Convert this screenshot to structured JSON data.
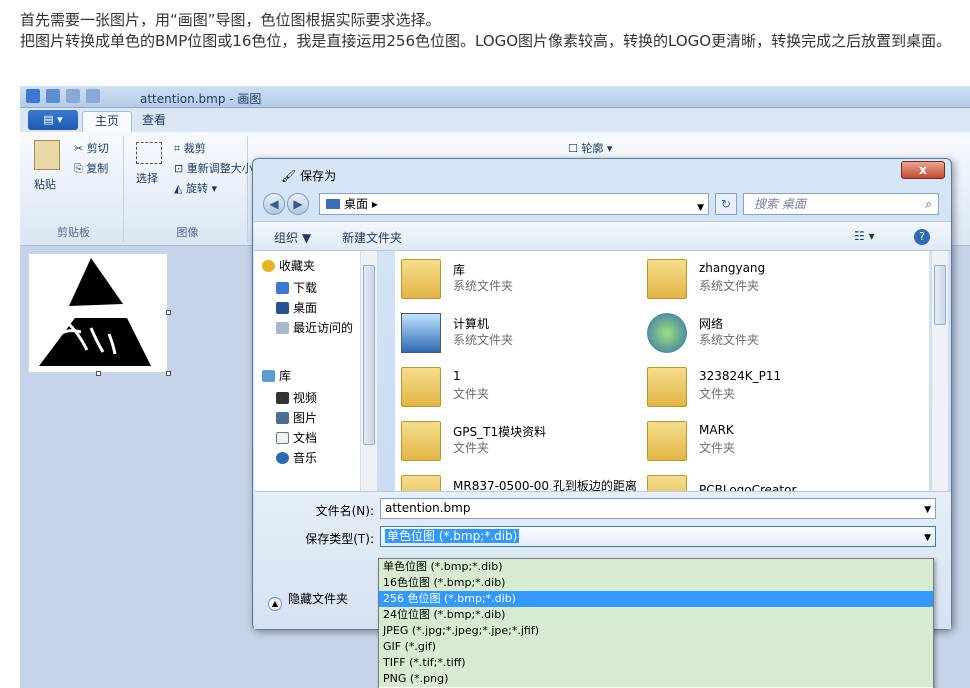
{
  "intro": {
    "line1": "首先需要一张图片，用“画图”导图，色位图根据实际要求选择。",
    "line2": "把图片转换成单色的BMP位图或16色位，我是直接运用256色位图。LOGO图片像素较高，转换的LOGO更清晰，转换完成之后放置到桌面。"
  },
  "paint": {
    "title": "attention.bmp - 画图",
    "tabs": [
      "主页",
      "查看"
    ],
    "clipboard": {
      "paste": "粘贴",
      "cut": "剪切",
      "copy": "复制",
      "group": "剪贴板"
    },
    "image": {
      "select": "选择",
      "crop": "裁剪",
      "resize": "重新调整大小",
      "rotate": "旋转",
      "group": "图像"
    },
    "outline": "轮廓"
  },
  "dialog": {
    "title": "保存为",
    "close": "x",
    "address": "桌面",
    "search_placeholder": "搜索 桌面",
    "organize": "组织 ▼",
    "new_folder": "新建文件夹",
    "nav": [
      {
        "label": "收藏夹",
        "icon": "star-icon"
      },
      {
        "label": "下载",
        "icon": "download-icon"
      },
      {
        "label": "桌面",
        "icon": "desktop-icon"
      },
      {
        "label": "最近访问的",
        "icon": "recent-icon"
      },
      {
        "label": "库",
        "icon": "library-icon"
      },
      {
        "label": "视频",
        "icon": "video-icon"
      },
      {
        "label": "图片",
        "icon": "picture-icon"
      },
      {
        "label": "文档",
        "icon": "document-icon"
      },
      {
        "label": "音乐",
        "icon": "music-icon"
      }
    ],
    "files": [
      {
        "name": "库",
        "type": "系统文件夹"
      },
      {
        "name": "zhangyang",
        "type": "系统文件夹"
      },
      {
        "name": "计算机",
        "type": "系统文件夹"
      },
      {
        "name": "网络",
        "type": "系统文件夹"
      },
      {
        "name": "1",
        "type": "文件夹"
      },
      {
        "name": "323824K_P11",
        "type": "文件夹"
      },
      {
        "name": "GPS_T1模块资料",
        "type": "文件夹"
      },
      {
        "name": "MARK",
        "type": "文件夹"
      },
      {
        "name": "MR837-0500-00 孔到板边的距离",
        "type": ""
      },
      {
        "name": "PCBLogoCreator",
        "type": ""
      }
    ],
    "filename_label": "文件名(N):",
    "filename_value": "attention.bmp",
    "filetype_label": "保存类型(T):",
    "filetype_value": "单色位图 (*.bmp;*.dib)",
    "hide_folders": "隐藏文件夹",
    "type_options": [
      "单色位图 (*.bmp;*.dib)",
      "16色位图 (*.bmp;*.dib)",
      "256 色位图 (*.bmp;*.dib)",
      "24位位图 (*.bmp;*.dib)",
      "JPEG (*.jpg;*.jpeg;*.jpe;*.jfif)",
      "GIF (*.gif)",
      "TIFF (*.tif;*.tiff)",
      "PNG (*.png)"
    ],
    "selected_option_index": 2
  }
}
